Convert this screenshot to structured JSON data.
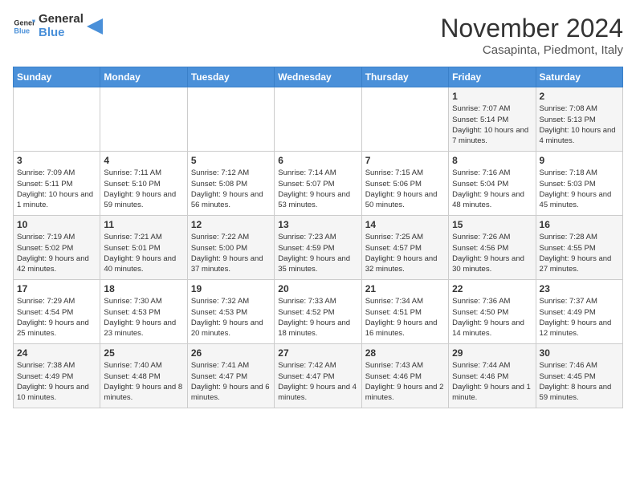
{
  "header": {
    "logo_line1": "General",
    "logo_line2": "Blue",
    "month": "November 2024",
    "location": "Casapinta, Piedmont, Italy"
  },
  "days_of_week": [
    "Sunday",
    "Monday",
    "Tuesday",
    "Wednesday",
    "Thursday",
    "Friday",
    "Saturday"
  ],
  "weeks": [
    [
      {
        "day": "",
        "info": ""
      },
      {
        "day": "",
        "info": ""
      },
      {
        "day": "",
        "info": ""
      },
      {
        "day": "",
        "info": ""
      },
      {
        "day": "",
        "info": ""
      },
      {
        "day": "1",
        "info": "Sunrise: 7:07 AM\nSunset: 5:14 PM\nDaylight: 10 hours and 7 minutes."
      },
      {
        "day": "2",
        "info": "Sunrise: 7:08 AM\nSunset: 5:13 PM\nDaylight: 10 hours and 4 minutes."
      }
    ],
    [
      {
        "day": "3",
        "info": "Sunrise: 7:09 AM\nSunset: 5:11 PM\nDaylight: 10 hours and 1 minute."
      },
      {
        "day": "4",
        "info": "Sunrise: 7:11 AM\nSunset: 5:10 PM\nDaylight: 9 hours and 59 minutes."
      },
      {
        "day": "5",
        "info": "Sunrise: 7:12 AM\nSunset: 5:08 PM\nDaylight: 9 hours and 56 minutes."
      },
      {
        "day": "6",
        "info": "Sunrise: 7:14 AM\nSunset: 5:07 PM\nDaylight: 9 hours and 53 minutes."
      },
      {
        "day": "7",
        "info": "Sunrise: 7:15 AM\nSunset: 5:06 PM\nDaylight: 9 hours and 50 minutes."
      },
      {
        "day": "8",
        "info": "Sunrise: 7:16 AM\nSunset: 5:04 PM\nDaylight: 9 hours and 48 minutes."
      },
      {
        "day": "9",
        "info": "Sunrise: 7:18 AM\nSunset: 5:03 PM\nDaylight: 9 hours and 45 minutes."
      }
    ],
    [
      {
        "day": "10",
        "info": "Sunrise: 7:19 AM\nSunset: 5:02 PM\nDaylight: 9 hours and 42 minutes."
      },
      {
        "day": "11",
        "info": "Sunrise: 7:21 AM\nSunset: 5:01 PM\nDaylight: 9 hours and 40 minutes."
      },
      {
        "day": "12",
        "info": "Sunrise: 7:22 AM\nSunset: 5:00 PM\nDaylight: 9 hours and 37 minutes."
      },
      {
        "day": "13",
        "info": "Sunrise: 7:23 AM\nSunset: 4:59 PM\nDaylight: 9 hours and 35 minutes."
      },
      {
        "day": "14",
        "info": "Sunrise: 7:25 AM\nSunset: 4:57 PM\nDaylight: 9 hours and 32 minutes."
      },
      {
        "day": "15",
        "info": "Sunrise: 7:26 AM\nSunset: 4:56 PM\nDaylight: 9 hours and 30 minutes."
      },
      {
        "day": "16",
        "info": "Sunrise: 7:28 AM\nSunset: 4:55 PM\nDaylight: 9 hours and 27 minutes."
      }
    ],
    [
      {
        "day": "17",
        "info": "Sunrise: 7:29 AM\nSunset: 4:54 PM\nDaylight: 9 hours and 25 minutes."
      },
      {
        "day": "18",
        "info": "Sunrise: 7:30 AM\nSunset: 4:53 PM\nDaylight: 9 hours and 23 minutes."
      },
      {
        "day": "19",
        "info": "Sunrise: 7:32 AM\nSunset: 4:53 PM\nDaylight: 9 hours and 20 minutes."
      },
      {
        "day": "20",
        "info": "Sunrise: 7:33 AM\nSunset: 4:52 PM\nDaylight: 9 hours and 18 minutes."
      },
      {
        "day": "21",
        "info": "Sunrise: 7:34 AM\nSunset: 4:51 PM\nDaylight: 9 hours and 16 minutes."
      },
      {
        "day": "22",
        "info": "Sunrise: 7:36 AM\nSunset: 4:50 PM\nDaylight: 9 hours and 14 minutes."
      },
      {
        "day": "23",
        "info": "Sunrise: 7:37 AM\nSunset: 4:49 PM\nDaylight: 9 hours and 12 minutes."
      }
    ],
    [
      {
        "day": "24",
        "info": "Sunrise: 7:38 AM\nSunset: 4:49 PM\nDaylight: 9 hours and 10 minutes."
      },
      {
        "day": "25",
        "info": "Sunrise: 7:40 AM\nSunset: 4:48 PM\nDaylight: 9 hours and 8 minutes."
      },
      {
        "day": "26",
        "info": "Sunrise: 7:41 AM\nSunset: 4:47 PM\nDaylight: 9 hours and 6 minutes."
      },
      {
        "day": "27",
        "info": "Sunrise: 7:42 AM\nSunset: 4:47 PM\nDaylight: 9 hours and 4 minutes."
      },
      {
        "day": "28",
        "info": "Sunrise: 7:43 AM\nSunset: 4:46 PM\nDaylight: 9 hours and 2 minutes."
      },
      {
        "day": "29",
        "info": "Sunrise: 7:44 AM\nSunset: 4:46 PM\nDaylight: 9 hours and 1 minute."
      },
      {
        "day": "30",
        "info": "Sunrise: 7:46 AM\nSunset: 4:45 PM\nDaylight: 8 hours and 59 minutes."
      }
    ]
  ]
}
